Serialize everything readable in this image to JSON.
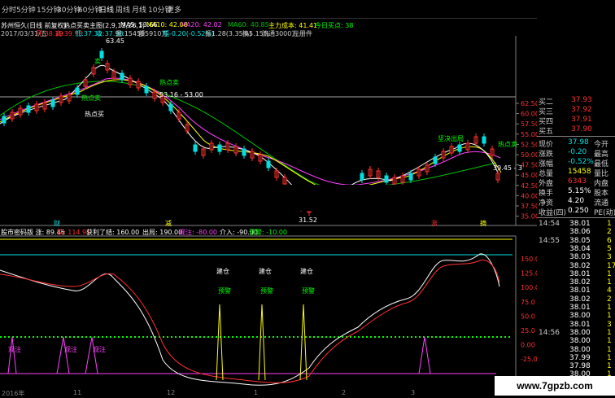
{
  "tabs": [
    "分时",
    "5分钟",
    "15分钟",
    "30分钟",
    "60分钟",
    "日线",
    "周线",
    "月线",
    "10分钟",
    "更多"
  ],
  "stock": {
    "name": "苏州恒久(日线 前复权)",
    "indicator": "热点买卖主图(2,9,12,26,1)",
    "ma5": "MA5: 53.66",
    "ma10": "MA10: 42.08",
    "ma20": "MA20: 42.02",
    "ma60": "MA60: 40.85",
    "cost": "主力成本: 41.41",
    "today_buy": "今日买点: 38"
  },
  "info_line": {
    "date": "2017/03/31/五",
    "open": "开:38.19",
    "high": "高:39.78",
    "low": "低:37.32",
    "close": "收:37.98",
    "vol": "量:15459",
    "amt": "额5910万",
    "chg": "幅-0.20(-0.52%)",
    "amp": "振1.28(3.35%)",
    "turnover": "换5.15%",
    "float": "流通3000万",
    "unit": "元册件"
  },
  "price_axis": [
    "62.50",
    "60.00",
    "57.50",
    "55.00",
    "52.50",
    "50.00",
    "47.50",
    "45.00",
    "42.50",
    "40.00",
    "37.50",
    "35.00"
  ],
  "price_labels": {
    "max": "63.45",
    "mid": "53.16 - 53.00",
    "low": "31.52",
    "right": "39.45 - 3"
  },
  "annotations": {
    "buy1": "热点买",
    "sell1": "热点卖",
    "sell2": "热点卖",
    "sell3": "坚决出局",
    "sell4": "热点卖",
    "dot": "卖"
  },
  "markers": [
    "财",
    "减",
    "涨",
    "摘"
  ],
  "lower": {
    "title": "股市密码版 涨: 89.46",
    "legend": [
      "跌: 114.91",
      "获利了结: 160.00",
      "出局: 190.00",
      "观注: -80.00",
      "介入: -90.00",
      "预警: -10.00"
    ],
    "axis": [
      "150.0",
      "125.0",
      "100.0",
      "75.0",
      "50.0",
      "25.0",
      "0.00",
      "-25.00"
    ],
    "labels": {
      "build1": "建仓",
      "build2": "建仓",
      "build3": "建仓",
      "warn1": "预警",
      "warn2": "预警",
      "warn3": "预警",
      "watch1": "观注",
      "watch2": "观注",
      "watch3": "观注"
    }
  },
  "dates": [
    "2016年",
    "11",
    "12",
    "1",
    "2",
    "3"
  ],
  "quote": [
    {
      "k": "买二",
      "v": "37.93"
    },
    {
      "k": "买三",
      "v": "37.92"
    },
    {
      "k": "买四",
      "v": "37.91"
    },
    {
      "k": "买五",
      "v": "37.90"
    }
  ],
  "stats": [
    {
      "k": "现价",
      "v": "37.98",
      "k2": "今开"
    },
    {
      "k": "涨跌",
      "v": "-0.20",
      "k2": "最高"
    },
    {
      "k": "涨幅",
      "v": "-0.52%",
      "k2": "最低"
    },
    {
      "k": "总量",
      "v": "15458",
      "k2": "量比"
    },
    {
      "k": "外盘",
      "v": "6343",
      "k2": "内盘"
    },
    {
      "k": "换手",
      "v": "5.15%",
      "k2": "股本"
    },
    {
      "k": "净资",
      "v": "4.20",
      "k2": "流通"
    },
    {
      "k": "收益(四)",
      "v": "0.250",
      "k2": "PE(动)"
    }
  ],
  "ticks": [
    {
      "t": "14:54",
      "p": "38.01",
      "v": "1"
    },
    {
      "t": "",
      "p": "38.06",
      "v": "2"
    },
    {
      "t": "14:55",
      "p": "38.05",
      "v": "6"
    },
    {
      "t": "",
      "p": "38.04",
      "v": "5"
    },
    {
      "t": "",
      "p": "38.03",
      "v": "3"
    },
    {
      "t": "",
      "p": "38.02",
      "v": "17"
    },
    {
      "t": "",
      "p": "38.01",
      "v": "1"
    },
    {
      "t": "",
      "p": "38.02",
      "v": "1"
    },
    {
      "t": "",
      "p": "38.01",
      "v": "4"
    },
    {
      "t": "",
      "p": "38.02",
      "v": "2"
    },
    {
      "t": "",
      "p": "38.01",
      "v": "1"
    },
    {
      "t": "",
      "p": "38.00",
      "v": "1"
    },
    {
      "t": "",
      "p": "38.01",
      "v": "3"
    },
    {
      "t": "14:56",
      "p": "38.00",
      "v": "1"
    },
    {
      "t": "",
      "p": "38.00",
      "v": "1"
    },
    {
      "t": "",
      "p": "38.00",
      "v": "1"
    },
    {
      "t": "",
      "p": "37.99",
      "v": "1"
    },
    {
      "t": "",
      "p": "37.98",
      "v": "1"
    },
    {
      "t": "",
      "p": "38.00",
      "v": "1"
    }
  ],
  "watermark": "www.7gpzb.com",
  "colors": {
    "up": "#ff3030",
    "down": "#00e0e0",
    "ma5": "#ffffff",
    "ma10": "#ffff00",
    "ma20": "#ff00ff",
    "ma60": "#00c000",
    "yellow": "#ffff00",
    "green": "#00ff00",
    "magenta": "#ff40ff"
  }
}
